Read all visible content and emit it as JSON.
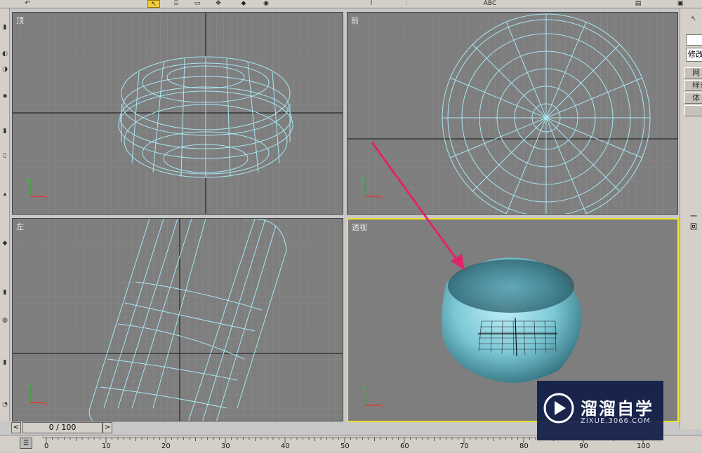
{
  "toolbar": {
    "icons": [
      "undo-icon",
      "select-arrow-icon",
      "select-region-icon",
      "rect-select-icon",
      "move-icon",
      "rotate-icon",
      "scale-icon",
      "mirror-icon",
      "align-icon",
      "abc-text-icon",
      "layer-icon",
      "render-icon"
    ],
    "abc_label": "ABC"
  },
  "viewports": {
    "top": {
      "label": "顶"
    },
    "front": {
      "label": "前"
    },
    "left": {
      "label": "左"
    },
    "perspective": {
      "label": "透视"
    }
  },
  "axis": {
    "x": "x",
    "y": "y",
    "z": "z"
  },
  "command_panel": {
    "modifier_label": "修改",
    "buttons": [
      "网",
      "样条",
      "体"
    ],
    "side_text": "一回"
  },
  "time_slider": {
    "prev": "<",
    "next": ">",
    "position": "0 / 100"
  },
  "trackbar": {
    "ticks": [
      "0",
      "10",
      "20",
      "30",
      "40",
      "50",
      "60",
      "70",
      "80",
      "90",
      "100"
    ]
  },
  "watermark": {
    "text_cn": "溜溜自学",
    "url": "ZIXUE.3066.COM"
  },
  "colors": {
    "viewport_bg": "#7e7e7e",
    "wireframe": "#a8e6f4",
    "active_border": "#f0e22a",
    "arrow": "#e0246a"
  }
}
